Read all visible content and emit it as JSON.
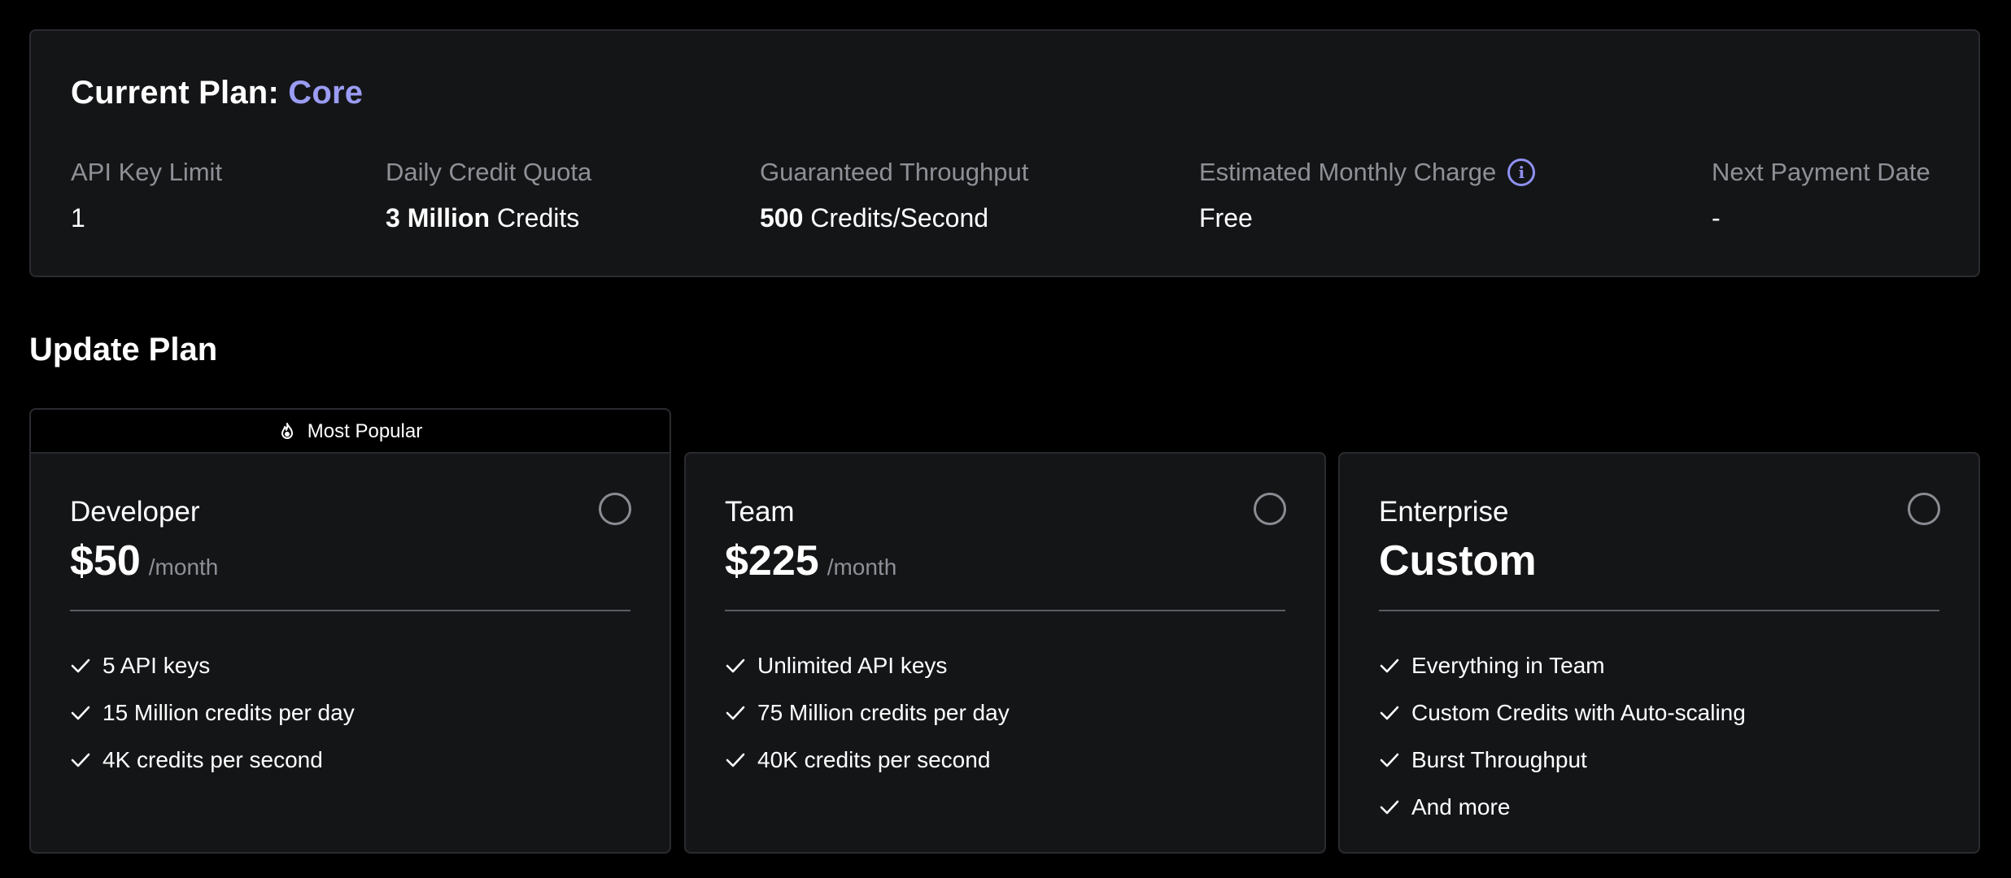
{
  "current_plan": {
    "title_prefix": "Current Plan:",
    "plan_name": "Core",
    "stats": [
      {
        "label": "API Key Limit",
        "value_bold": "",
        "value": "1"
      },
      {
        "label": "Daily Credit Quota",
        "value_bold": "3 Million",
        "value": "Credits"
      },
      {
        "label": "Guaranteed Throughput",
        "value_bold": "500",
        "value": "Credits/Second"
      },
      {
        "label": "Estimated Monthly Charge",
        "value_bold": "",
        "value": "Free",
        "info_icon": "info-icon"
      },
      {
        "label": "Next Payment Date",
        "value_bold": "",
        "value": "-"
      }
    ]
  },
  "update_plan": {
    "title": "Update Plan",
    "popular_badge": "Most Popular",
    "popular_icon": "fire-icon",
    "plans": [
      {
        "name": "Developer",
        "price": "$50",
        "period": "/month",
        "selected": false,
        "features": [
          "5 API keys",
          "15 Million credits per day",
          "4K credits per second"
        ]
      },
      {
        "name": "Team",
        "price": "$225",
        "period": "/month",
        "selected": false,
        "features": [
          "Unlimited API keys",
          "75 Million credits per day",
          "40K credits per second"
        ]
      },
      {
        "name": "Enterprise",
        "price": "Custom",
        "period": "",
        "selected": false,
        "features": [
          "Everything in Team",
          "Custom Credits with Auto-scaling",
          "Burst Throughput",
          "And more"
        ]
      }
    ]
  },
  "colors": {
    "accent": "#9b9cf3",
    "background": "#000000",
    "panel": "#141517",
    "border": "#2a2b2f",
    "muted_text": "#8e9096"
  }
}
